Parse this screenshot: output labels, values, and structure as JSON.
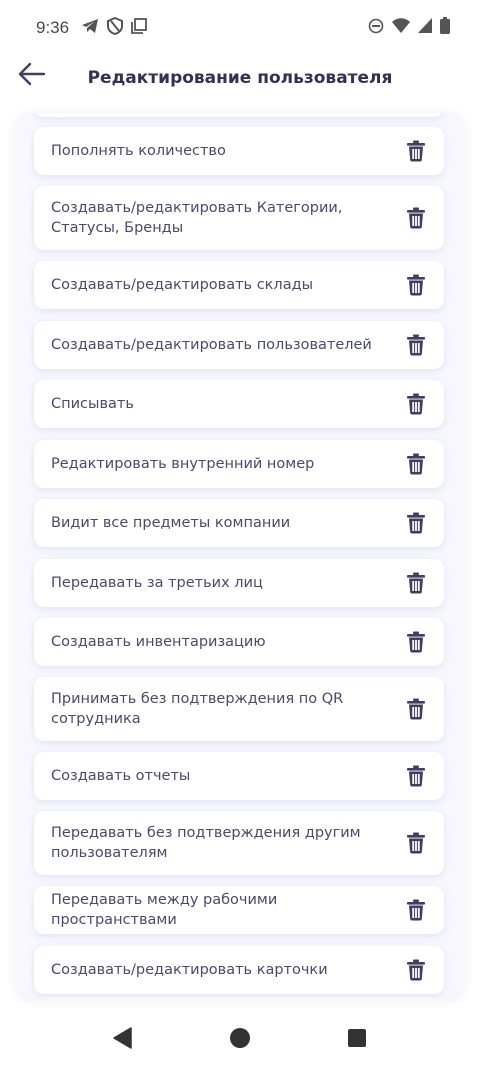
{
  "status_bar": {
    "time": "9:36",
    "left_icons": [
      "telegram-icon",
      "shield-icon",
      "copy-icon"
    ],
    "right_icons": [
      "dnd-icon",
      "wifi-icon",
      "signal-icon",
      "battery-icon"
    ]
  },
  "header": {
    "title": "Редактирование пользователя",
    "back_icon": "arrow-left-icon"
  },
  "colors": {
    "accent": "#3d3f66",
    "panel_bg": "#f7f7fd",
    "card_bg": "#ffffff",
    "text": "#474a73"
  },
  "permissions": [
    {
      "label": "Пополнять количество"
    },
    {
      "label": "Создавать/редактировать Категории, Статусы, Бренды"
    },
    {
      "label": "Создавать/редактировать склады"
    },
    {
      "label": "Создавать/редактировать пользователей"
    },
    {
      "label": "Списывать"
    },
    {
      "label": "Редактировать внутренний номер"
    },
    {
      "label": "Видит все предметы компании"
    },
    {
      "label": "Передавать за третьих лиц"
    },
    {
      "label": "Создавать инвентаризацию"
    },
    {
      "label": "Принимать без подтверждения по QR сотрудника"
    },
    {
      "label": "Создавать отчеты"
    },
    {
      "label": "Передавать без подтверждения другим пользователям"
    },
    {
      "label": "Передавать между рабочими пространствами"
    },
    {
      "label": "Создавать/редактировать карточки"
    }
  ],
  "item_action_icon": "trash-icon",
  "nav_bar": {
    "buttons": [
      "back-triangle-icon",
      "home-circle-icon",
      "recents-square-icon"
    ]
  }
}
